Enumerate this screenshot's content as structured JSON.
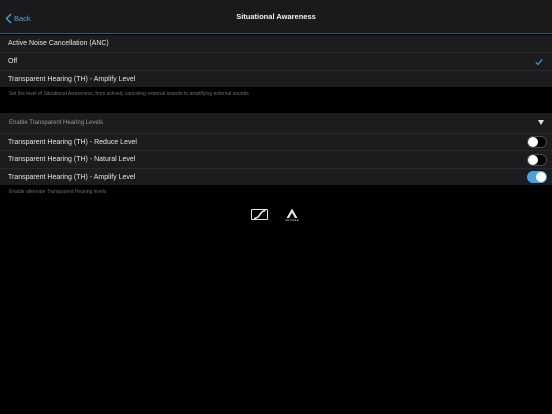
{
  "nav": {
    "back_label": "Back",
    "title": "Situational Awareness"
  },
  "anc": {
    "options": [
      {
        "label": "Active Noise Cancellation (ANC)",
        "selected": false
      },
      {
        "label": "Off",
        "selected": true
      },
      {
        "label": "Transparent Hearing (TH) - Amplify Level",
        "selected": false
      }
    ],
    "helper": "Set the level of Situational Awareness, from actively canceling external sounds to amplifying external sounds"
  },
  "th_levels": {
    "header": "Enable Transparent Hearing Levels",
    "items": [
      {
        "label": "Transparent Hearing (TH) - Reduce Level",
        "enabled": false
      },
      {
        "label": "Transparent Hearing (TH) - Natural Level",
        "enabled": false
      },
      {
        "label": "Transparent Hearing (TH) - Amplify Level",
        "enabled": true
      }
    ],
    "helper": "Enable alternate Transparent Hearing levels"
  },
  "logos": {
    "sennheiser": "sennheiser-logo",
    "apogee_word": "APOGEE"
  },
  "colors": {
    "accent": "#4aa3df",
    "background": "#000000",
    "row": "#1c1c1e",
    "navbar": "#1a1a1c"
  }
}
